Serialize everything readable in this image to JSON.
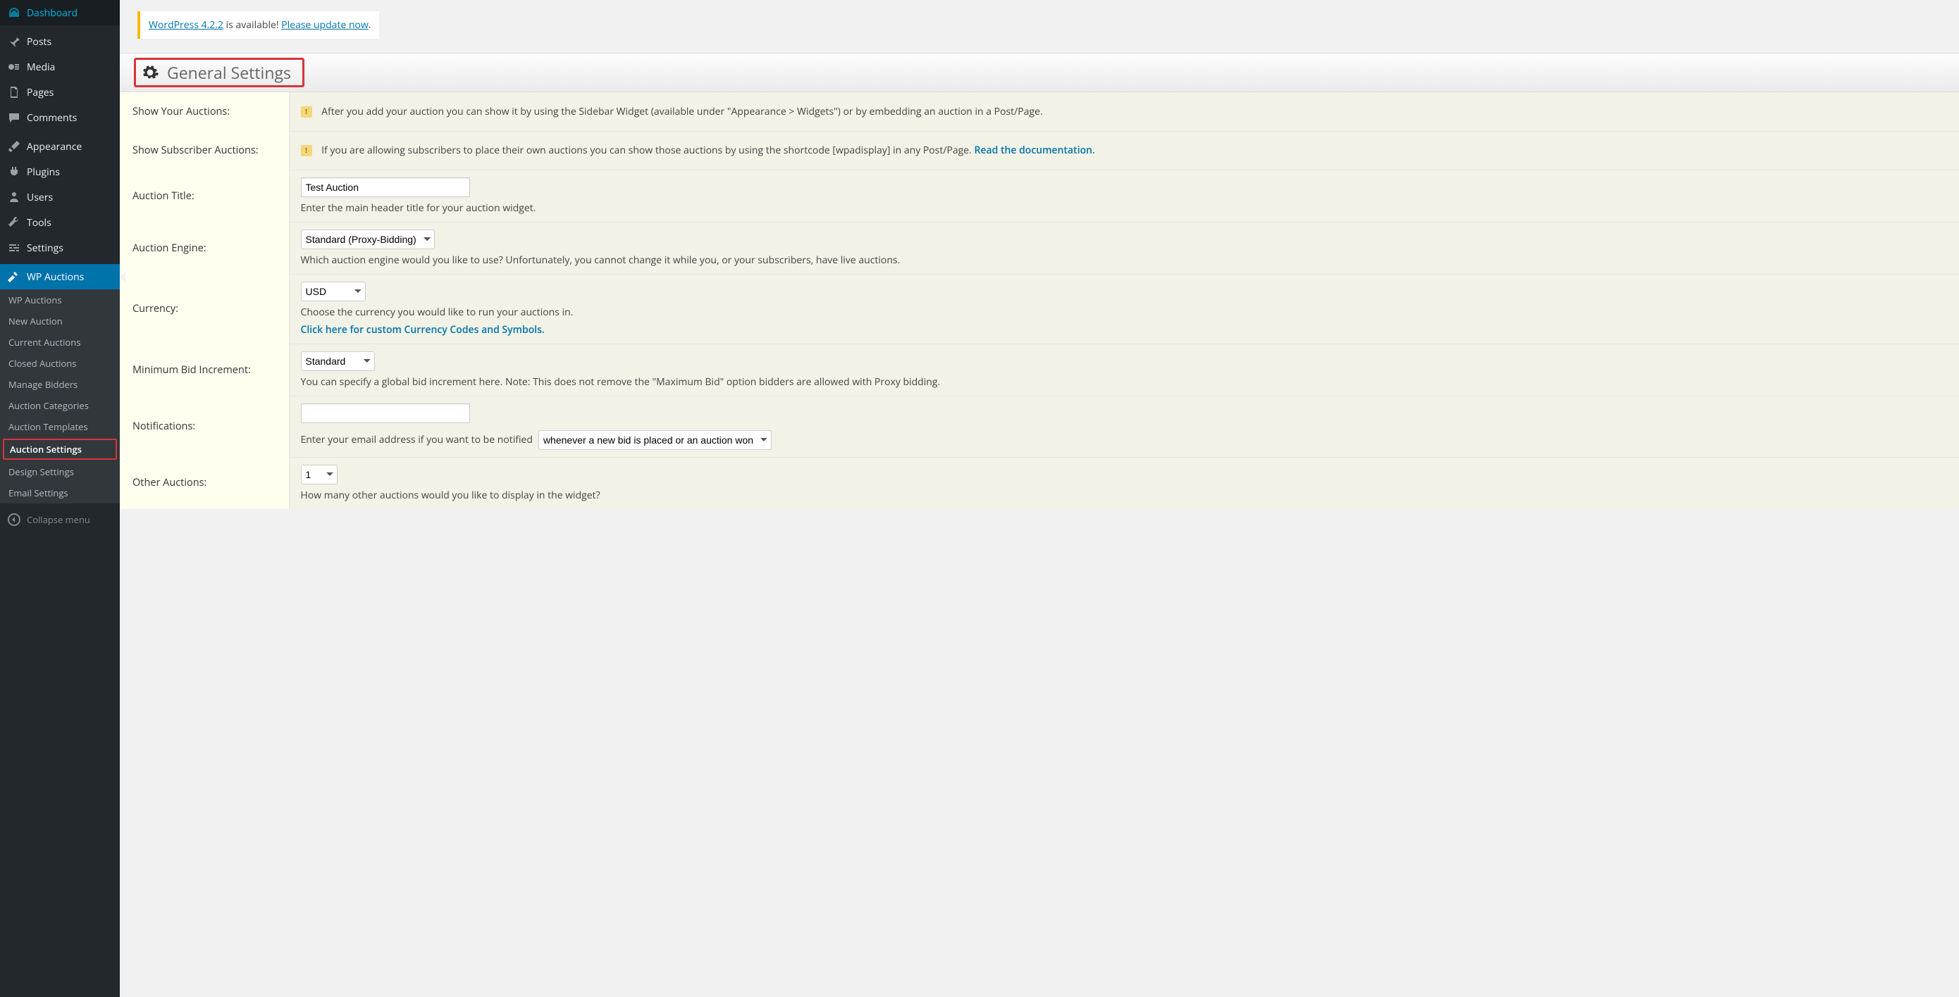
{
  "sidebar": {
    "items": [
      {
        "label": "Dashboard",
        "icon": "dashboard"
      },
      {
        "label": "Posts",
        "icon": "pin"
      },
      {
        "label": "Media",
        "icon": "media"
      },
      {
        "label": "Pages",
        "icon": "pages"
      },
      {
        "label": "Comments",
        "icon": "comment"
      },
      {
        "label": "Appearance",
        "icon": "brush"
      },
      {
        "label": "Plugins",
        "icon": "plug"
      },
      {
        "label": "Users",
        "icon": "user"
      },
      {
        "label": "Tools",
        "icon": "wrench"
      },
      {
        "label": "Settings",
        "icon": "sliders"
      },
      {
        "label": "WP Auctions",
        "icon": "hammer",
        "current": true
      }
    ],
    "submenu": [
      {
        "label": "WP Auctions"
      },
      {
        "label": "New Auction"
      },
      {
        "label": "Current Auctions"
      },
      {
        "label": "Closed Auctions"
      },
      {
        "label": "Manage Bidders"
      },
      {
        "label": "Auction Categories"
      },
      {
        "label": "Auction Templates"
      },
      {
        "label": "Auction Settings",
        "current": true
      },
      {
        "label": "Design Settings"
      },
      {
        "label": "Email Settings"
      }
    ],
    "collapse_label": "Collapse menu"
  },
  "update_nag": {
    "link1": "WordPress 4.2.2",
    "mid_text": " is available! ",
    "link2": "Please update now",
    "end": "."
  },
  "page_title": "General Settings",
  "rows": {
    "show_auctions": {
      "label": "Show Your Auctions:",
      "text": "After you add your auction you can show it by using the Sidebar Widget (available under \"Appearance > Widgets\") or by embedding an auction in a Post/Page."
    },
    "show_subscriber": {
      "label": "Show Subscriber Auctions:",
      "text_before": "If you are allowing subscribers to place their own auctions you can show those auctions by using the shortcode [wpadisplay] in any Post/Page. ",
      "link": "Read the documentation.",
      "text_after": ""
    },
    "auction_title": {
      "label": "Auction Title:",
      "value": "Test Auction",
      "desc": "Enter the main header title for your auction widget."
    },
    "auction_engine": {
      "label": "Auction Engine:",
      "value": "Standard (Proxy-Bidding)",
      "desc": "Which auction engine would you like to use? Unfortunately, you cannot change it while you, or your subscribers, have live auctions."
    },
    "currency": {
      "label": "Currency:",
      "value": "USD",
      "desc": "Choose the currency you would like to run your auctions in.",
      "link": "Click here for custom Currency Codes and Symbols."
    },
    "min_bid": {
      "label": "Minimum Bid Increment:",
      "value": "Standard",
      "desc": "You can specify a global bid increment here. Note: This does not remove the \"Maximum Bid\" option bidders are allowed with Proxy bidding."
    },
    "notifications": {
      "label": "Notifications:",
      "email_value": "",
      "desc_before": "Enter your email address if you want to be notified",
      "select_value": "whenever a new bid is placed or an auction won"
    },
    "other_auctions": {
      "label": "Other Auctions:",
      "value": "1",
      "desc": "How many other auctions would you like to display in the widget?"
    }
  }
}
